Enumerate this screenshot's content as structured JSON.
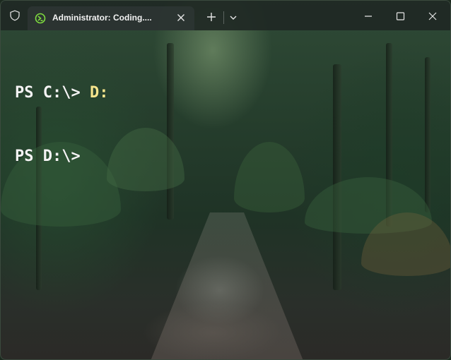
{
  "window": {
    "tab_title": "Administrator: Coding....",
    "tab_close_glyph": "✕",
    "new_tab_glyph": "+",
    "icons": {
      "shield": "shield-icon",
      "tab": "powershell-icon",
      "dropdown": "chevron-down-icon",
      "minimize": "minimize-icon",
      "maximize": "maximize-icon",
      "close": "close-icon"
    }
  },
  "terminal": {
    "lines": [
      {
        "prompt": "PS C:\\> ",
        "command": "D:"
      },
      {
        "prompt": "PS D:\\> ",
        "command": ""
      }
    ],
    "colors": {
      "text": "#f4f4f4",
      "command": "#f6e58d"
    }
  }
}
